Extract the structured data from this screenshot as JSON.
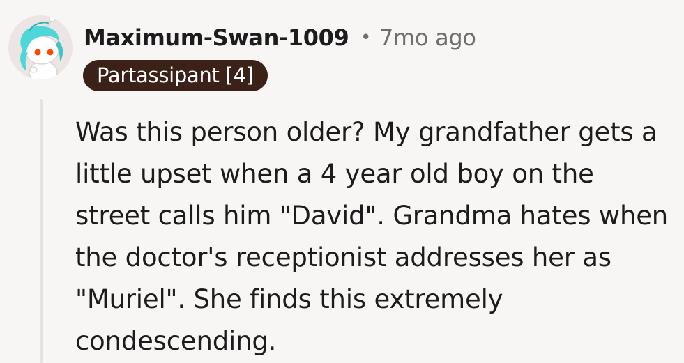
{
  "comment": {
    "author": "Maximum-Swan-1009",
    "separator": "•",
    "timestamp": "7mo ago",
    "flair": "Partassipant [4]",
    "avatar_icon": "snoo-avatar-icon",
    "body_lines": [
      "Was this person older? My grandfather gets a",
      "little upset when a 4 year old boy on the",
      "street calls him \"David\". Grandma hates when",
      "the doctor's receptionist addresses her as",
      "\"Muriel\". She finds this extremely",
      "condescending."
    ]
  },
  "colors": {
    "background": "#f8f6f5",
    "flair_background": "#3b2118",
    "text": "#1c1c1c",
    "meta_text": "#6e6e6e",
    "thread_line": "#e6e2df",
    "avatar_hair": "#4fd6d9"
  }
}
